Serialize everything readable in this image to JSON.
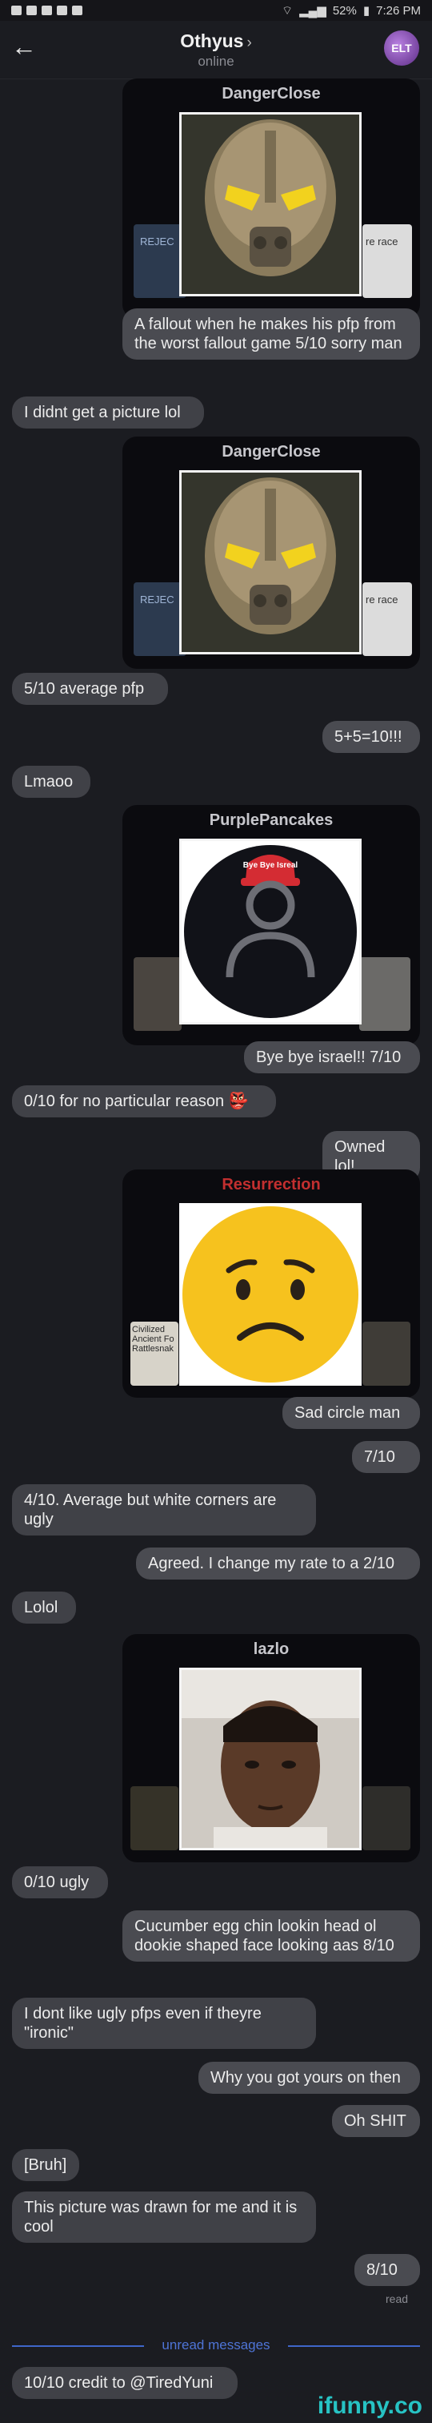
{
  "status_bar": {
    "battery": "52%",
    "time": "7:26 PM"
  },
  "header": {
    "back_icon": "arrow-left-icon",
    "title": "Othyus",
    "chevron": "›",
    "subtitle": "online",
    "avatar_text": "ELT"
  },
  "cards": [
    {
      "name": "DangerClose",
      "left_text": "REJEC",
      "right_text": "re race"
    },
    {
      "name": "DangerClose",
      "left_text": "REJEC",
      "right_text": "re race"
    },
    {
      "name": "PurplePancakes",
      "hat_text": "Bye Bye Isreal"
    },
    {
      "name": "Resurrection",
      "left_text": "Civilized Ancient Fo Rattlesnak"
    },
    {
      "name": "lazlo"
    }
  ],
  "messages": [
    "A fallout when he makes his pfp from the worst fallout game 5/10 sorry man",
    "I didnt get a picture lol",
    "5/10 average pfp",
    "5+5=10!!!",
    "Lmaoo",
    "Bye bye israel!! 7/10",
    "0/10 for no particular reason 👺",
    "Owned lol!",
    "Sad circle man",
    "7/10",
    "4/10. Average but white corners are ugly",
    "Agreed. I change my rate to a 2/10",
    "Lolol",
    "0/10 ugly",
    "Cucumber egg chin lookin head ol dookie shaped face looking aas 8/10",
    "I dont like ugly pfps even if theyre \"ironic\"",
    "Why you got yours on then",
    "Oh SHIT",
    "[Bruh]",
    "This picture was drawn for me and it is cool",
    "8/10",
    "10/10 credit to @TiredYuni"
  ],
  "read_label": "read",
  "separator": "unread messages",
  "watermark": "ifunny.co"
}
